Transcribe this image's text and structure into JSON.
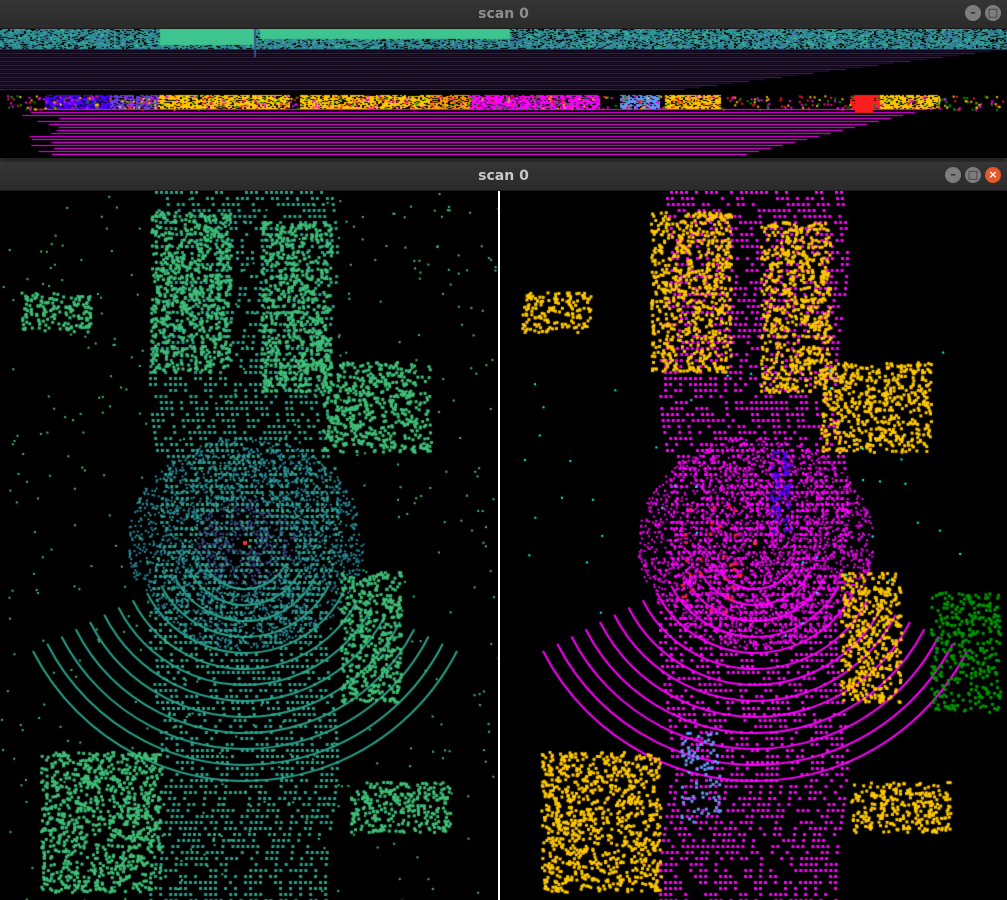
{
  "windows": {
    "range_window": {
      "title": "scan 0",
      "buttons": {
        "minimize": "–",
        "maximize": "□",
        "close": "×"
      }
    },
    "bev_window": {
      "title": "scan 0",
      "buttons": {
        "minimize": "–",
        "maximize": "□",
        "close": "×"
      }
    }
  },
  "colors": {
    "background": "#000000",
    "divider": "#ffffff",
    "desktop": "#3a3a3a",
    "close_button": "#e4582b",
    "viridis_low": "#440154",
    "viridis_mid": "#2a9a8a",
    "viridis_high": "#40c070",
    "semantic": {
      "road": "#ff00ff",
      "sidewalk": "#4b0082",
      "building": "#ffc800",
      "vegetation": "#009600",
      "car": "#6496f5",
      "person": "#ff1e1e",
      "pole": "#00ffff",
      "trunk": "#4b00ff"
    }
  },
  "icons": {
    "minimize": "minimize-icon",
    "maximize": "maximize-icon",
    "close": "close-icon"
  }
}
